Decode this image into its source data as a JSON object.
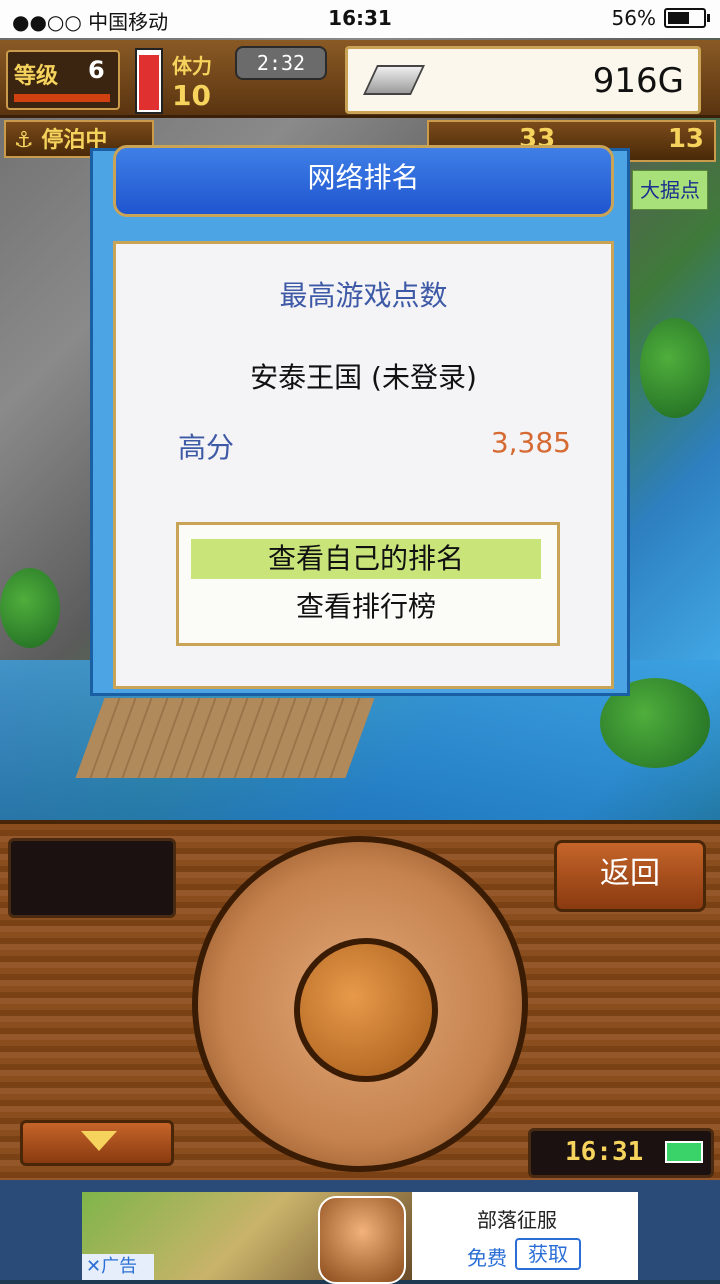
{
  "status_bar": {
    "carrier": "●●○○ 中国移动",
    "wifi": "wifi-icon",
    "time": "16:31",
    "battery_text": "56%",
    "battery_level": 0.56
  },
  "hud": {
    "level_label": "等级",
    "level_value": "6",
    "stamina_label": "体力",
    "stamina_value": "10",
    "timer": "2:32",
    "gold": "916G",
    "moored_label": "停泊中",
    "right_count_a": "33",
    "right_count_b": "13",
    "big_base_button": "大据点"
  },
  "dialog": {
    "title": "网络排名",
    "heading": "最高游戏点数",
    "kingdom": "安泰王国 (未登录)",
    "score_label": "高分",
    "score_value": "3,385",
    "menu": [
      "查看自己的排名",
      "查看排行榜"
    ]
  },
  "controls": {
    "back": "返回",
    "clock": "16:31"
  },
  "ad": {
    "title": "部落征服",
    "free": "免费",
    "get": "获取",
    "tag": "✕广告"
  },
  "colors": {
    "dialog_blue": "#4da4e4",
    "title_blue": "#1f55d0",
    "selected_row": "#c9e57a",
    "score_orange": "#d56a33",
    "gold_border": "#c9a356"
  }
}
